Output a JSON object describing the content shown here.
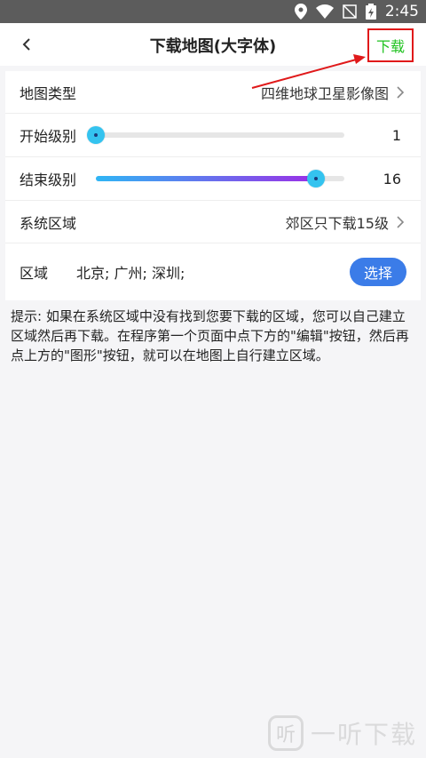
{
  "status": {
    "time": "2:45"
  },
  "header": {
    "title": "下载地图(大字体)",
    "download_label": "下载"
  },
  "rows": {
    "map_type": {
      "label": "地图类型",
      "value": "四维地球卫星影像图"
    },
    "start_level": {
      "label": "开始级别",
      "value": "1",
      "level_fraction": 0.0
    },
    "end_level": {
      "label": "结束级别",
      "value": "16",
      "level_fraction": 0.885
    },
    "system_region": {
      "label": "系统区域",
      "value": "郊区只下载15级"
    },
    "region": {
      "label": "区域",
      "value": "北京; 广州; 深圳;",
      "button_label": "选择"
    }
  },
  "hint": "提示: 如果在系统区域中没有找到您要下载的区域，您可以自己建立区域然后再下载。在程序第一个页面中点下方的\"编辑\"按钮，然后再点上方的\"图形\"按钮，就可以在地图上自行建立区域。",
  "watermark": {
    "text": "一听下载"
  },
  "colors": {
    "accent": "#3b7ce8",
    "download_text": "#1fc21f",
    "highlight_box": "#e0191a"
  }
}
